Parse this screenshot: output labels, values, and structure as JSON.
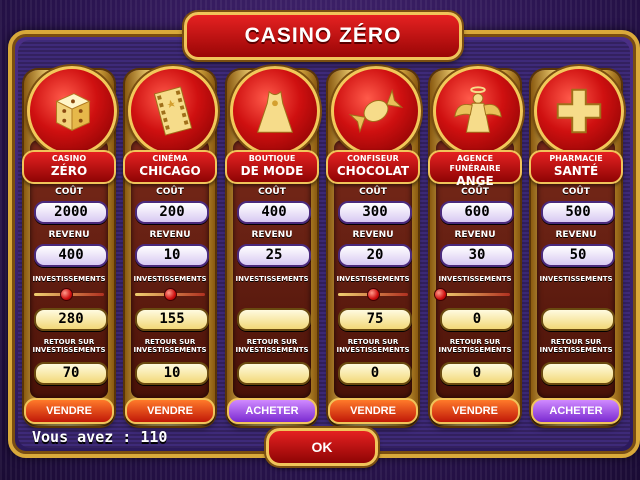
{
  "title": "CASINO ZÉRO",
  "labels": {
    "cost": "COÛT",
    "revenue": "REVENU",
    "investments": "INVESTISSEMENTS",
    "roi_line1": "RETOUR SUR",
    "roi_line2": "INVESTISSEMENTS"
  },
  "businesses": [
    {
      "small": "CASINO",
      "big": "ZÉRO",
      "icon": "dice-icon",
      "cost": "2000",
      "revenue": "400",
      "investment_value": "280",
      "investment_level": 0.45,
      "roi": "70",
      "action": "VENDRE",
      "action_type": "sell",
      "has_slider": true
    },
    {
      "small": "CINÉMA",
      "big": "CHICAGO",
      "icon": "film-icon",
      "cost": "200",
      "revenue": "10",
      "investment_value": "155",
      "investment_level": 0.5,
      "roi": "10",
      "action": "VENDRE",
      "action_type": "sell",
      "has_slider": true
    },
    {
      "small": "BOUTIQUE",
      "big": "DE MODE",
      "icon": "dress-icon",
      "cost": "400",
      "revenue": "25",
      "investment_value": "",
      "investment_level": null,
      "roi": "",
      "action": "ACHETER",
      "action_type": "buy",
      "has_slider": false
    },
    {
      "small": "CONFISEUR",
      "big": "CHOCOLAT",
      "icon": "candy-icon",
      "cost": "300",
      "revenue": "20",
      "investment_value": "75",
      "investment_level": 0.5,
      "roi": "0",
      "action": "VENDRE",
      "action_type": "sell",
      "has_slider": true
    },
    {
      "small": "AGENCE FUNÉRAIRE",
      "big": "ANGE",
      "icon": "angel-icon",
      "cost": "600",
      "revenue": "30",
      "investment_value": "0",
      "investment_level": 0.0,
      "roi": "0",
      "action": "VENDRE",
      "action_type": "sell",
      "has_slider": true
    },
    {
      "small": "PHARMACIE",
      "big": "SANTÉ",
      "icon": "cross-icon",
      "cost": "500",
      "revenue": "50",
      "investment_value": "",
      "investment_level": null,
      "roi": "",
      "action": "ACHETER",
      "action_type": "buy",
      "has_slider": false
    }
  ],
  "money_text": "Vous avez : 110",
  "ok_label": "OK",
  "colors": {
    "panel_red": "#cf1010",
    "gold": "#f0c45a",
    "purple": "#3e2a79",
    "sell_orange": "#e04410",
    "buy_purple": "#9a4ae0"
  }
}
